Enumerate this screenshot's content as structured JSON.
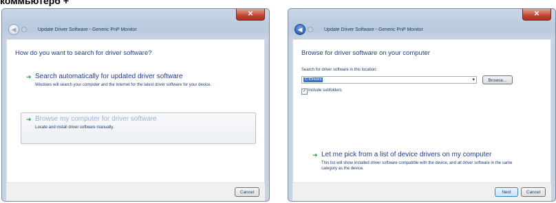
{
  "caption": "коммьютерб +",
  "left_window": {
    "title": "Update Driver Software - Generic PnP Monitor",
    "close_glyph": "✕",
    "heading": "How do you want to search for driver software?",
    "options": [
      {
        "title": "Search automatically for updated driver software",
        "desc": "Windows will search your computer and the Internet for the latest driver software for your device."
      },
      {
        "title": "Browse my computer for driver software",
        "desc": "Locate and install driver software manually."
      }
    ],
    "cancel_label": "Cancel"
  },
  "right_window": {
    "title": "Update Driver Software - Generic PnP Monitor",
    "close_glyph": "✕",
    "heading": "Browse for driver software on your computer",
    "search_label": "Search for driver software in this location:",
    "location_value": "C:\\Drivers",
    "browse_label": "Browse...",
    "include_subfolders_label": "Include subfolders",
    "pick_title": "Let me pick from a list of device drivers on my computer",
    "pick_desc": "This list will show installed driver software compatible with the device, and all driver software in the same category as the device.",
    "next_label": "Next",
    "cancel_label": "Cancel"
  },
  "icons": {
    "arrow": "green-arrow-icon",
    "back": "back-arrow-icon",
    "close": "close-icon"
  },
  "colors": {
    "heading_blue": "#1e3d8f",
    "arrow_green": "#2e9e3e",
    "close_red": "#c0462e"
  }
}
